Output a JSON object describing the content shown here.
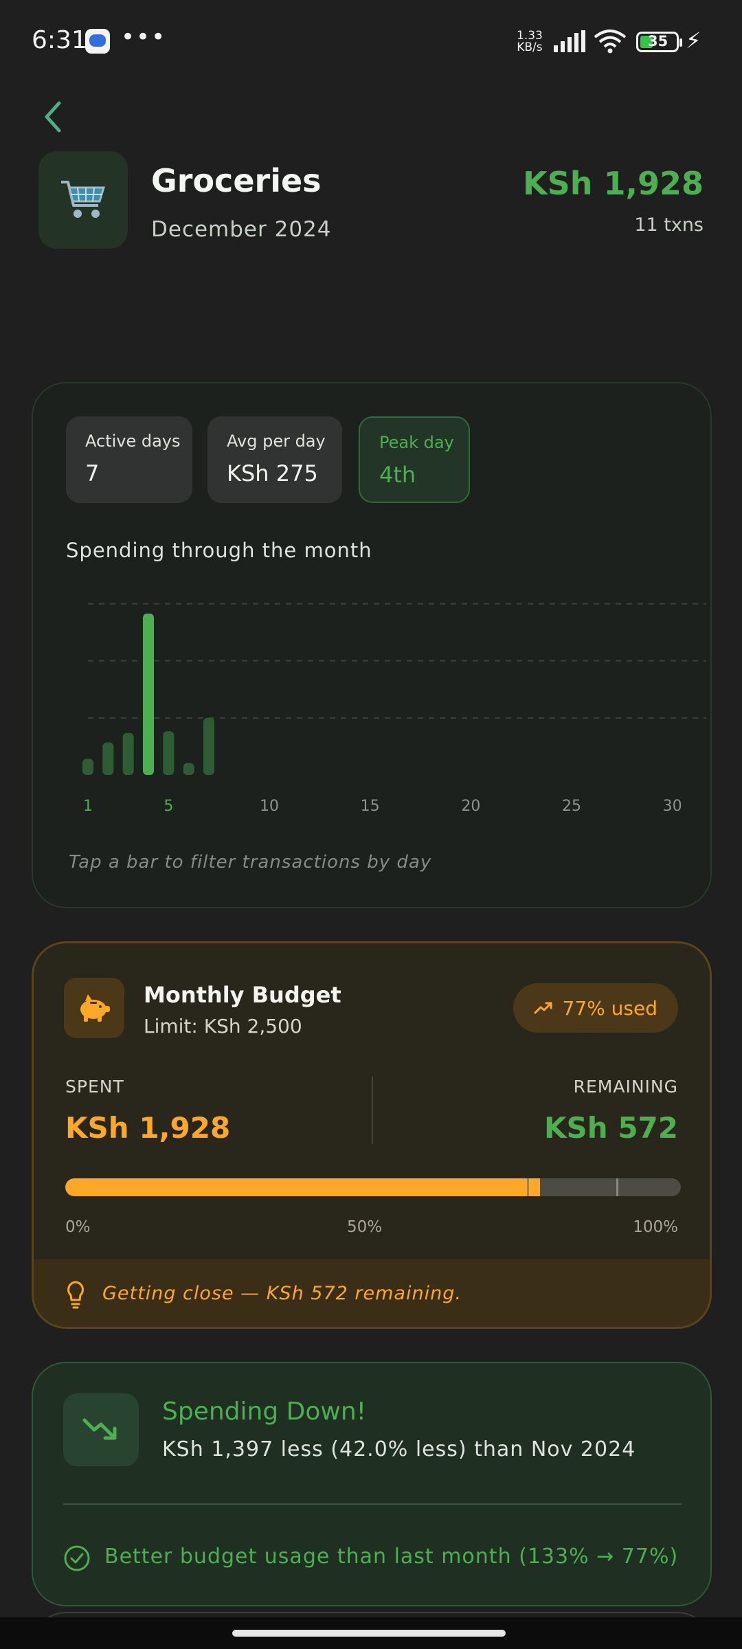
{
  "status_bar": {
    "time": "6:31",
    "dots": "•••",
    "speed_value": "1.33",
    "speed_unit": "KB/s",
    "battery": "35"
  },
  "header": {
    "category": "Groceries",
    "month": "December 2024",
    "total": "KSh 1,928",
    "txns": "11 txns",
    "icon": "shopping-cart-icon"
  },
  "activity": {
    "stats": [
      {
        "label": "Active days",
        "value": "7"
      },
      {
        "label": "Avg per day",
        "value": "KSh 275"
      },
      {
        "label": "Peak day",
        "value": "4th"
      }
    ],
    "chart_title": "Spending through the month",
    "hint": "Tap a bar to filter transactions by day"
  },
  "chart_data": {
    "type": "bar",
    "title": "Spending through the month",
    "xlabel": "",
    "ylabel": "",
    "x": [
      1,
      2,
      3,
      4,
      5,
      6,
      7
    ],
    "values": [
      95,
      190,
      245,
      940,
      255,
      70,
      333
    ],
    "ylim": [
      0,
      1000
    ],
    "xlim": [
      1,
      31
    ],
    "x_ticks": [
      "1",
      "5",
      "10",
      "15",
      "20",
      "25",
      "30"
    ],
    "highlighted_ticks": [
      "1",
      "5"
    ],
    "peak_day": 4,
    "grid": "horizontal dashed",
    "colors": {
      "bar": "#2e5d33",
      "peak": "#4caf50",
      "grid": "#3b403c"
    }
  },
  "budget": {
    "title": "Monthly Budget",
    "limit": "Limit: KSh 2,500",
    "used": "77% used",
    "spent_label": "SPENT",
    "spent": "KSh 1,928",
    "remaining_label": "REMAINING",
    "remaining": "KSh 572",
    "progress": 0.771,
    "scale": [
      "0%",
      "50%",
      "100%"
    ],
    "tip": "Getting close — KSh 572 remaining.",
    "colors": {
      "accent": "#ffa726",
      "good": "#4caf50"
    }
  },
  "trend": {
    "title": "Spending Down!",
    "description": "KSh 1,397 less (42.0% less) than Nov 2024",
    "note": "Better budget usage than last month (133% → 77%)"
  }
}
